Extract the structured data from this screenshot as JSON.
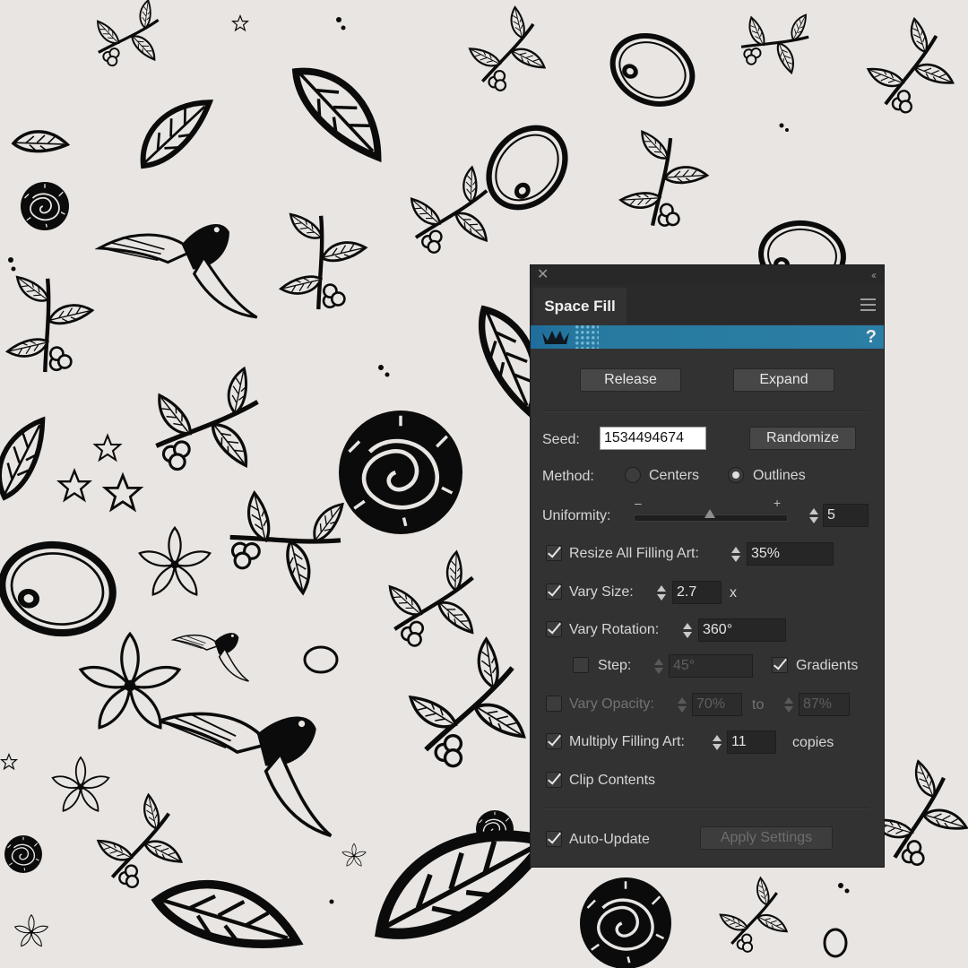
{
  "panel": {
    "title": "Space Fill",
    "help_label": "?",
    "buttons": {
      "release": "Release",
      "expand": "Expand",
      "randomize": "Randomize",
      "apply": "Apply Settings"
    },
    "seed": {
      "label": "Seed:",
      "value": "1534494674"
    },
    "method": {
      "label": "Method:",
      "option_centers": "Centers",
      "option_outlines": "Outlines",
      "selected": "Outlines"
    },
    "uniformity": {
      "label": "Uniformity:",
      "minus": "–",
      "plus": "+",
      "value": "5",
      "level": 5
    },
    "resize": {
      "label": "Resize All Filling Art:",
      "value": "35%",
      "checked": true
    },
    "vary_size": {
      "label": "Vary Size:",
      "value": "2.7",
      "suffix": "x",
      "checked": true
    },
    "vary_rotation": {
      "label": "Vary Rotation:",
      "value": "360°",
      "checked": true
    },
    "step": {
      "label": "Step:",
      "value": "45°",
      "checked": false
    },
    "gradients": {
      "label": "Gradients",
      "checked": true
    },
    "vary_opacity": {
      "label": "Vary Opacity:",
      "from": "70%",
      "to_label": "to",
      "to": "87%",
      "checked": false
    },
    "multiply": {
      "label": "Multiply Filling Art:",
      "value": "11",
      "suffix": "copies",
      "checked": true
    },
    "clip": {
      "label": "Clip Contents",
      "checked": true
    },
    "auto_update": {
      "label": "Auto-Update",
      "checked": true
    }
  },
  "colors": {
    "canvas": "#e8e5e2",
    "panel": "#323232",
    "banner": "#2b7ea5",
    "ink": "#0b0b0b"
  }
}
